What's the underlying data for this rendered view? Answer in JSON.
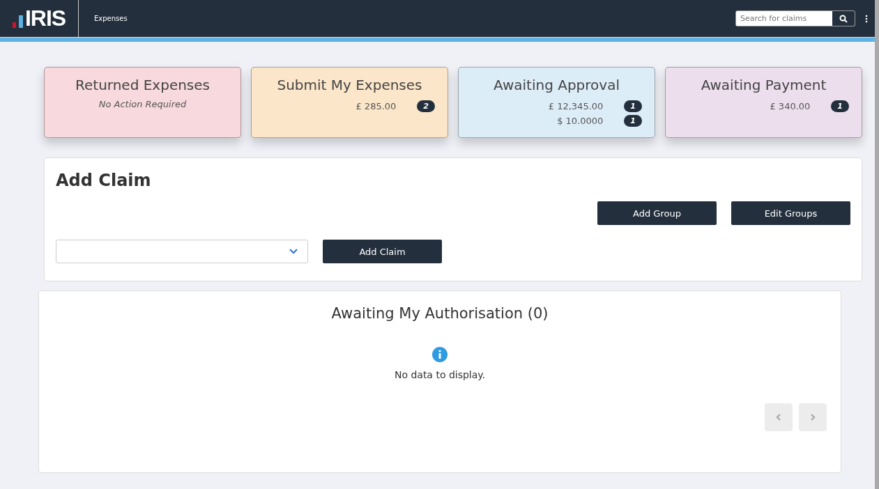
{
  "header": {
    "logo": "IRIS",
    "nav_label": "Expenses",
    "search": {
      "placeholder": "Search for claims"
    }
  },
  "cards": [
    {
      "title": "Returned Expenses",
      "color": "#f7d9de",
      "note": "No Action Required"
    },
    {
      "title": "Submit My Expenses",
      "color": "#fbe6c9",
      "amounts": [
        {
          "amount": "£ 285.00",
          "count": "2"
        }
      ]
    },
    {
      "title": "Awaiting Approval",
      "color": "#ddedf8",
      "amounts": [
        {
          "amount": "£ 12,345.00",
          "count": "1"
        },
        {
          "amount": "$ 10.0000",
          "count": "1"
        }
      ]
    },
    {
      "title": "Awaiting Payment",
      "color": "#eddeed",
      "amounts": [
        {
          "amount": "£ 340.00",
          "count": "1"
        }
      ]
    }
  ],
  "add_claim": {
    "title": "Add Claim",
    "group_buttons": [
      "Add Group",
      "Edit Groups"
    ],
    "submit_button": "Add Claim"
  },
  "authorisation": {
    "title": "Awaiting My Authorisation (0)",
    "empty_message": "No data to display.",
    "pager": [
      {
        "kind": "prev",
        "disabled": true
      },
      {
        "kind": "next",
        "disabled": true
      }
    ]
  }
}
